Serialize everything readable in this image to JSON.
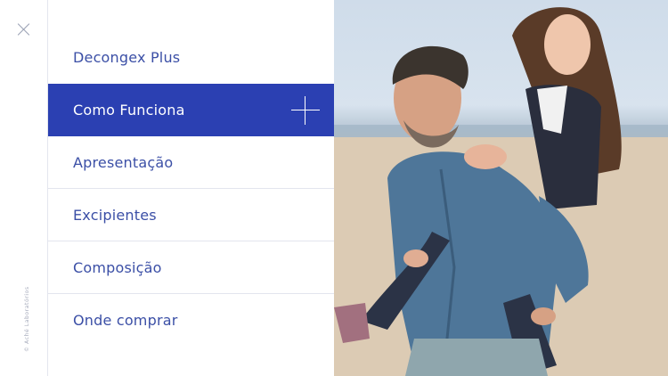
{
  "sidebar": {
    "copyright": "© Aché Laboratórios"
  },
  "menu": {
    "items": [
      {
        "label": "Decongex Plus"
      },
      {
        "label": "Como Funciona"
      },
      {
        "label": "Apresentação"
      },
      {
        "label": "Excipientes"
      },
      {
        "label": "Composição"
      },
      {
        "label": "Onde comprar"
      }
    ],
    "active_index": 1
  },
  "colors": {
    "accent": "#2b40b2",
    "menu_text": "#3b4fa6"
  }
}
